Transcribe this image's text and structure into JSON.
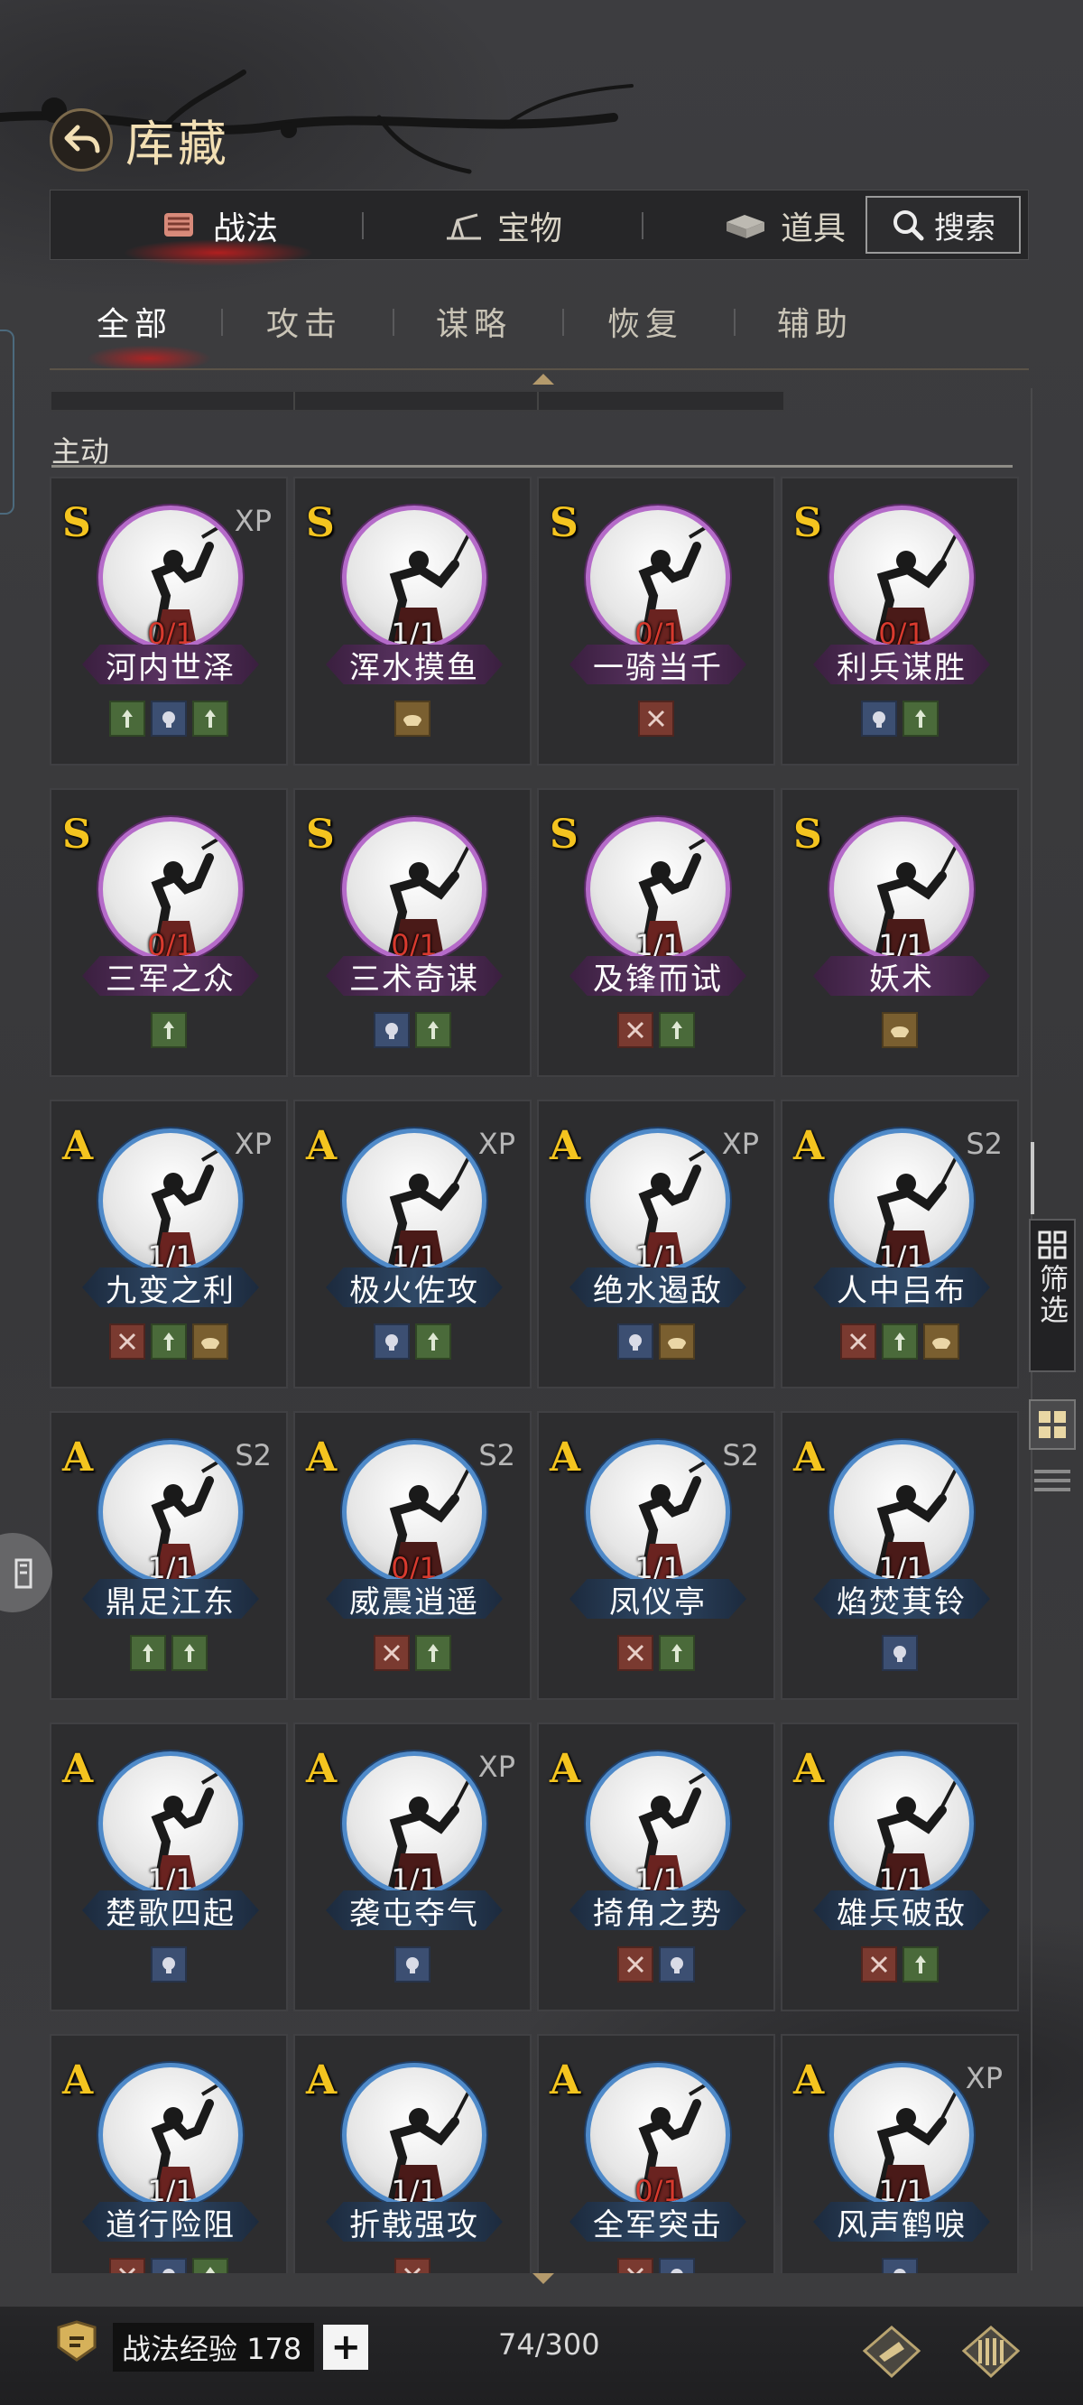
{
  "header": {
    "title": "库藏"
  },
  "primary_tabs": [
    {
      "label": "战法",
      "icon": "scroll-icon",
      "active": true
    },
    {
      "label": "宝物",
      "icon": "treasure-icon",
      "active": false
    },
    {
      "label": "道具",
      "icon": "item-icon",
      "active": false
    }
  ],
  "search": {
    "label": "搜索"
  },
  "sub_tabs": [
    {
      "label": "全部",
      "active": true
    },
    {
      "label": "攻击",
      "active": false
    },
    {
      "label": "谋略",
      "active": false
    },
    {
      "label": "恢复",
      "active": false
    },
    {
      "label": "辅助",
      "active": false
    }
  ],
  "section": {
    "title": "主动"
  },
  "cards": [
    {
      "grade": "S",
      "tag": "XP",
      "count": "0/1",
      "count_red": true,
      "name": "河内世泽",
      "icons": [
        "green",
        "blue",
        "green"
      ]
    },
    {
      "grade": "S",
      "tag": "",
      "count": "1/1",
      "count_red": false,
      "name": "浑水摸鱼",
      "icons": [
        "gold"
      ]
    },
    {
      "grade": "S",
      "tag": "",
      "count": "0/1",
      "count_red": true,
      "name": "一骑当千",
      "icons": [
        "red"
      ]
    },
    {
      "grade": "S",
      "tag": "",
      "count": "0/1",
      "count_red": true,
      "name": "利兵谋胜",
      "icons": [
        "blue",
        "green"
      ]
    },
    {
      "grade": "S",
      "tag": "",
      "count": "0/1",
      "count_red": true,
      "name": "三军之众",
      "icons": [
        "green"
      ]
    },
    {
      "grade": "S",
      "tag": "",
      "count": "0/1",
      "count_red": true,
      "name": "三术奇谋",
      "icons": [
        "blue",
        "green"
      ]
    },
    {
      "grade": "S",
      "tag": "",
      "count": "1/1",
      "count_red": false,
      "name": "及锋而试",
      "icons": [
        "red",
        "green"
      ]
    },
    {
      "grade": "S",
      "tag": "",
      "count": "1/1",
      "count_red": false,
      "name": "妖术",
      "icons": [
        "gold"
      ]
    },
    {
      "grade": "A",
      "tag": "XP",
      "count": "1/1",
      "count_red": false,
      "name": "九变之利",
      "icons": [
        "red",
        "green",
        "gold"
      ]
    },
    {
      "grade": "A",
      "tag": "XP",
      "count": "1/1",
      "count_red": false,
      "name": "极火佐攻",
      "icons": [
        "blue",
        "green"
      ]
    },
    {
      "grade": "A",
      "tag": "XP",
      "count": "1/1",
      "count_red": false,
      "name": "绝水遏敌",
      "icons": [
        "blue",
        "gold"
      ]
    },
    {
      "grade": "A",
      "tag": "S2",
      "count": "1/1",
      "count_red": false,
      "name": "人中吕布",
      "icons": [
        "red",
        "green",
        "gold"
      ]
    },
    {
      "grade": "A",
      "tag": "S2",
      "count": "1/1",
      "count_red": false,
      "name": "鼎足江东",
      "icons": [
        "green",
        "green"
      ]
    },
    {
      "grade": "A",
      "tag": "S2",
      "count": "0/1",
      "count_red": true,
      "name": "威震逍遥",
      "icons": [
        "red",
        "green"
      ]
    },
    {
      "grade": "A",
      "tag": "S2",
      "count": "1/1",
      "count_red": false,
      "name": "凤仪亭",
      "icons": [
        "red",
        "green"
      ]
    },
    {
      "grade": "A",
      "tag": "",
      "count": "1/1",
      "count_red": false,
      "name": "焰焚萁铃",
      "icons": [
        "blue"
      ]
    },
    {
      "grade": "A",
      "tag": "",
      "count": "1/1",
      "count_red": false,
      "name": "楚歌四起",
      "icons": [
        "blue"
      ]
    },
    {
      "grade": "A",
      "tag": "XP",
      "count": "1/1",
      "count_red": false,
      "name": "袭屯夺气",
      "icons": [
        "blue"
      ]
    },
    {
      "grade": "A",
      "tag": "",
      "count": "1/1",
      "count_red": false,
      "name": "掎角之势",
      "icons": [
        "red",
        "blue"
      ]
    },
    {
      "grade": "A",
      "tag": "",
      "count": "1/1",
      "count_red": false,
      "name": "雄兵破敌",
      "icons": [
        "red",
        "green"
      ]
    },
    {
      "grade": "A",
      "tag": "",
      "count": "1/1",
      "count_red": false,
      "name": "道行险阻",
      "icons": [
        "red",
        "blue",
        "green"
      ]
    },
    {
      "grade": "A",
      "tag": "",
      "count": "1/1",
      "count_red": false,
      "name": "折戟强攻",
      "icons": [
        "red"
      ]
    },
    {
      "grade": "A",
      "tag": "",
      "count": "0/1",
      "count_red": true,
      "name": "全军突击",
      "icons": [
        "red",
        "blue"
      ]
    },
    {
      "grade": "A",
      "tag": "XP",
      "count": "1/1",
      "count_red": false,
      "name": "风声鹤唳",
      "icons": [
        "blue"
      ]
    }
  ],
  "side": {
    "filter_label": "筛选"
  },
  "bottom": {
    "xp_label": "战法经验",
    "xp_value": "178",
    "plus": "+",
    "capacity": "74/300"
  },
  "colors": {
    "grade_gold": "#f4c41f",
    "s_ring": "#b56bc9",
    "a_ring": "#4f8ac9",
    "count_red": "#d83a2e"
  }
}
